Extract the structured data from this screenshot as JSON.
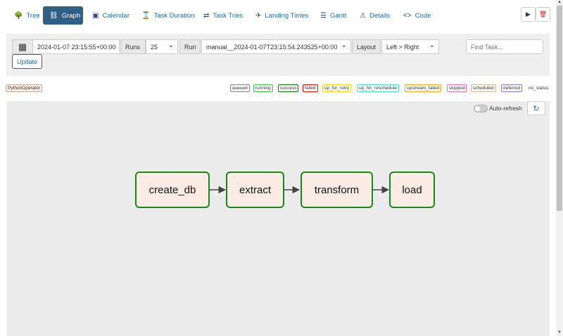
{
  "nav": {
    "tabs": [
      {
        "label": "Tree",
        "icon": "tree-icon",
        "glyph": "🌳"
      },
      {
        "label": "Graph",
        "icon": "graph-icon",
        "glyph": "⛓"
      },
      {
        "label": "Calendar",
        "icon": "calendar-icon",
        "glyph": "▣"
      },
      {
        "label": "Task Duration",
        "icon": "hourglass-icon",
        "glyph": "⌛"
      },
      {
        "label": "Task Tries",
        "icon": "retry-icon",
        "glyph": "⇄"
      },
      {
        "label": "Landing Times",
        "icon": "landing-icon",
        "glyph": "✈"
      },
      {
        "label": "Gantt",
        "icon": "gantt-icon",
        "glyph": "☰"
      },
      {
        "label": "Details",
        "icon": "warning-icon",
        "glyph": "⚠"
      },
      {
        "label": "Code",
        "icon": "code-icon",
        "glyph": "<>"
      }
    ],
    "active_tab": "Graph",
    "trigger_icon": "▶",
    "delete_icon": "🗑"
  },
  "filter": {
    "calendar_glyph": "▦",
    "date_value": "2024-01-07 23:15:55+00:00",
    "runs_label": "Runs",
    "runs_value": "25",
    "run_label": "Run",
    "run_value": "manual__2024-01-07T23:15:54.243525+00:00",
    "layout_label": "Layout",
    "layout_value": "Left > Right",
    "find_placeholder": "Find Task...",
    "update_label": "Update"
  },
  "legend": {
    "operator": "PythonOperator",
    "states": [
      {
        "label": "queued",
        "color": "#808080"
      },
      {
        "label": "running",
        "color": "#32cd32"
      },
      {
        "label": "success",
        "color": "#008000"
      },
      {
        "label": "failed",
        "color": "#ff0000"
      },
      {
        "label": "up_for_retry",
        "color": "#ffd700"
      },
      {
        "label": "up_for_reschedule",
        "color": "#40e0d0"
      },
      {
        "label": "upstream_failed",
        "color": "#ffa500"
      },
      {
        "label": "skipped",
        "color": "#ff69b4"
      },
      {
        "label": "scheduled",
        "color": "#d2b48c"
      },
      {
        "label": "deferred",
        "color": "#9370db"
      },
      {
        "label": "no_status",
        "color": ""
      }
    ]
  },
  "graph": {
    "auto_refresh_label": "Auto-refresh",
    "auto_refresh_on": false,
    "refresh_glyph": "↻",
    "nodes": [
      {
        "label": "create_db",
        "state": "success"
      },
      {
        "label": "extract",
        "state": "success"
      },
      {
        "label": "transform",
        "state": "success"
      },
      {
        "label": "load",
        "state": "success"
      }
    ]
  }
}
